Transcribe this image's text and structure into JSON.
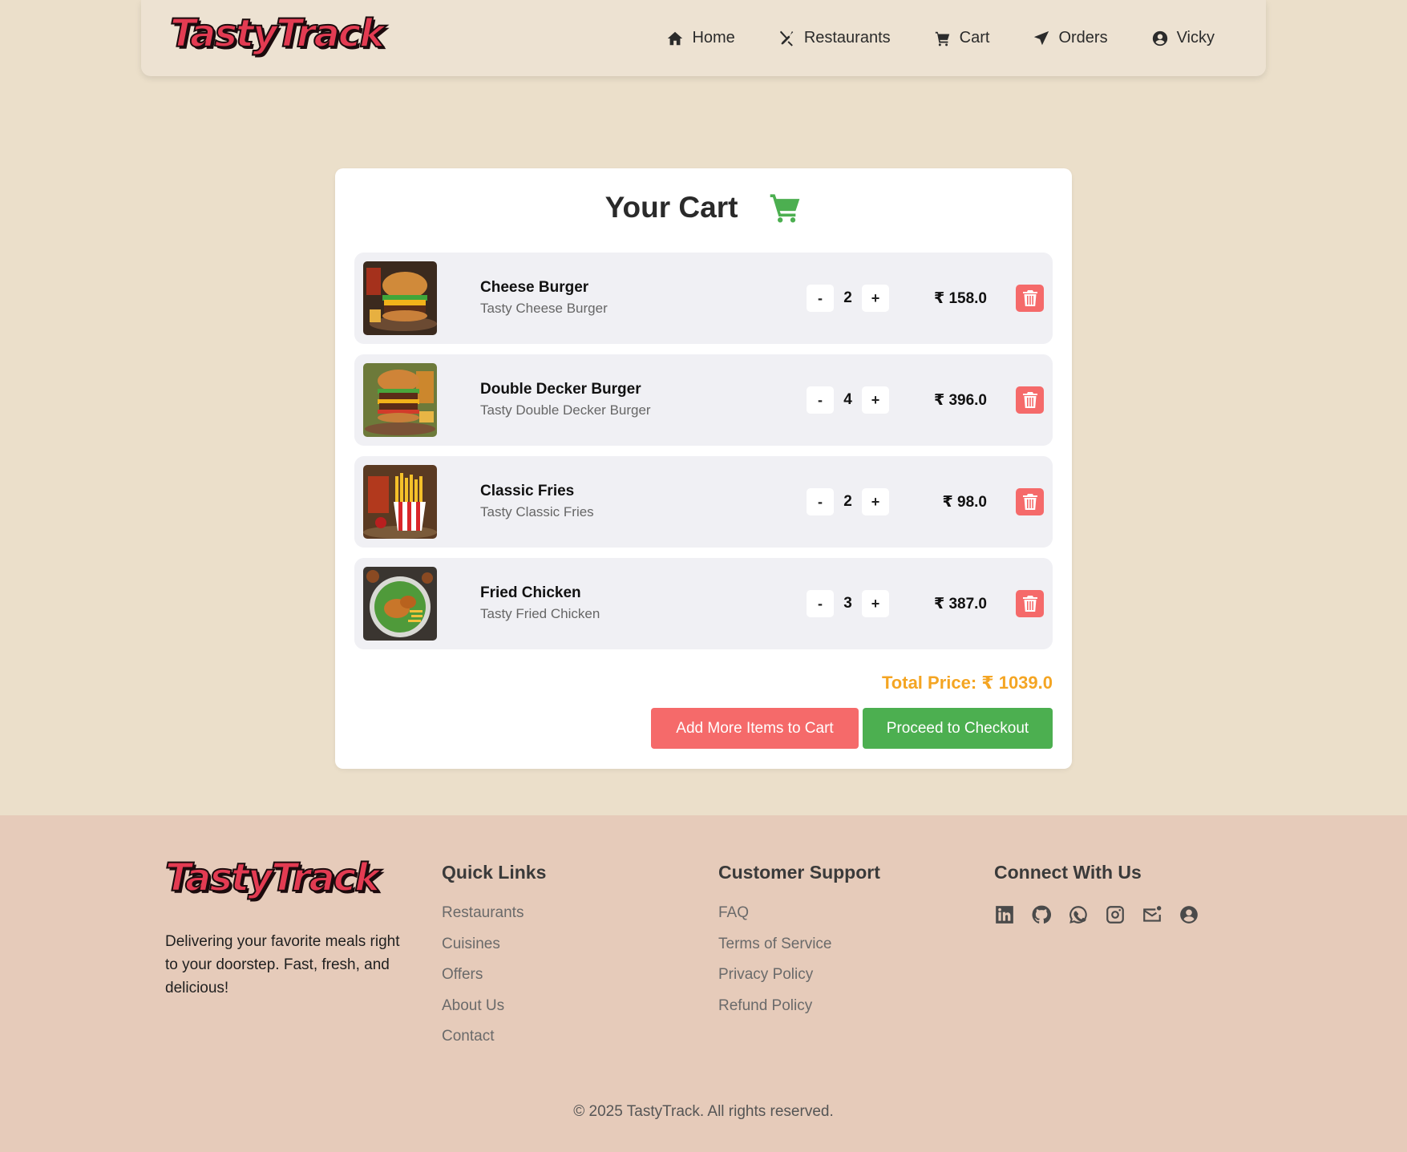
{
  "brand": {
    "name": "TastyTrack"
  },
  "nav": {
    "items": [
      {
        "label": "Home",
        "icon": "home-icon"
      },
      {
        "label": "Restaurants",
        "icon": "utensils-icon"
      },
      {
        "label": "Cart",
        "icon": "cart-icon"
      },
      {
        "label": "Orders",
        "icon": "paper-plane-icon"
      },
      {
        "label": "Vicky",
        "icon": "user-circle-icon"
      }
    ]
  },
  "cart": {
    "title": "Your Cart",
    "title_icon": "cart-icon",
    "items": [
      {
        "name": "Cheese Burger",
        "desc": "Tasty Cheese Burger",
        "qty": "2",
        "price": "₹ 158.0",
        "image": "cheese-burger-image"
      },
      {
        "name": "Double Decker Burger",
        "desc": "Tasty Double Decker Burger",
        "qty": "4",
        "price": "₹ 396.0",
        "image": "double-decker-burger-image"
      },
      {
        "name": "Classic Fries",
        "desc": "Tasty Classic Fries",
        "qty": "2",
        "price": "₹ 98.0",
        "image": "classic-fries-image"
      },
      {
        "name": "Fried Chicken",
        "desc": "Tasty Fried Chicken",
        "qty": "3",
        "price": "₹ 387.0",
        "image": "fried-chicken-image"
      }
    ],
    "minus_label": "-",
    "plus_label": "+",
    "total_label": "Total Price: ₹ 1039.0",
    "add_more_label": "Add More Items to Cart",
    "checkout_label": "Proceed to Checkout"
  },
  "footer": {
    "tagline": "Delivering your favorite meals right to your doorstep. Fast, fresh, and delicious!",
    "quick_links": {
      "title": "Quick Links",
      "links": [
        "Restaurants",
        "Cuisines",
        "Offers",
        "About Us",
        "Contact"
      ]
    },
    "support": {
      "title": "Customer Support",
      "links": [
        "FAQ",
        "Terms of Service",
        "Privacy Policy",
        "Refund Policy"
      ]
    },
    "connect": {
      "title": "Connect With Us",
      "icons": [
        "linkedin-icon",
        "github-icon",
        "whatsapp-icon",
        "instagram-icon",
        "email-icon",
        "user-circle-icon"
      ]
    },
    "copyright": "© 2025 TastyTrack. All rights reserved."
  },
  "colors": {
    "page_bg": "#ebdfca",
    "nav_bg": "#ede2d2",
    "footer_bg": "#e6cbba",
    "accent_green": "#4caf50",
    "accent_red": "#f56a6a",
    "total_orange": "#f4a523",
    "brand_red": "#e33b52"
  }
}
